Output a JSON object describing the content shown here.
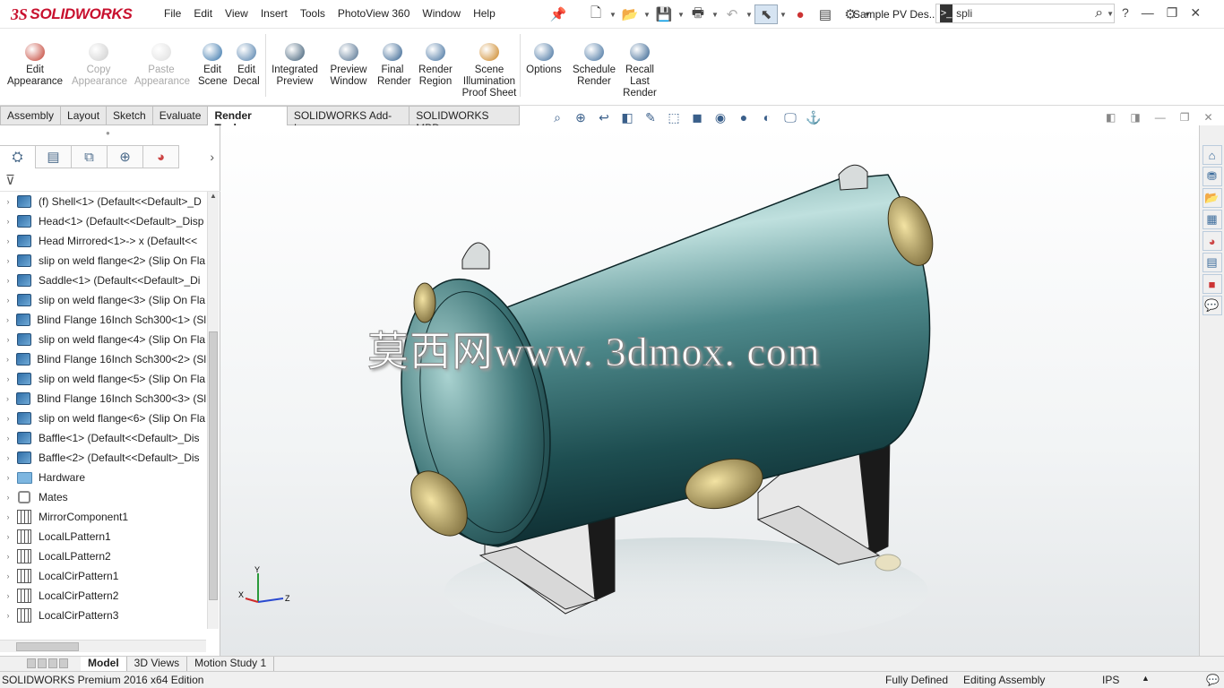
{
  "app": {
    "logo_ds": "3S",
    "logo_name": "SOLIDWORKS",
    "doc_title": "Sample PV Des..."
  },
  "menu": [
    "File",
    "Edit",
    "View",
    "Insert",
    "Tools",
    "PhotoView 360",
    "Window",
    "Help"
  ],
  "search": {
    "value": "spli"
  },
  "ribbon": [
    {
      "label": "Edit\nAppearance",
      "icon": "edit-appearance-icon",
      "enabled": true,
      "color": "#c0392b"
    },
    {
      "label": "Copy\nAppearance",
      "icon": "copy-appearance-icon",
      "enabled": false,
      "color": "#cccccc"
    },
    {
      "label": "Paste\nAppearance",
      "icon": "paste-appearance-icon",
      "enabled": false,
      "color": "#dddddd"
    },
    {
      "label": "Edit\nScene",
      "icon": "edit-scene-icon",
      "enabled": true,
      "color": "#2e6ea6"
    },
    {
      "label": "Edit\nDecal",
      "icon": "edit-decal-icon",
      "enabled": true,
      "color": "#4a7aa8"
    },
    {
      "label": "Integrated\nPreview",
      "icon": "integrated-preview-icon",
      "enabled": true,
      "color": "#35556f"
    },
    {
      "label": "Preview\nWindow",
      "icon": "preview-window-icon",
      "enabled": true,
      "color": "#4a6a8a"
    },
    {
      "label": "Final\nRender",
      "icon": "final-render-icon",
      "enabled": true,
      "color": "#2a5a8a"
    },
    {
      "label": "Render\nRegion",
      "icon": "render-region-icon",
      "enabled": true,
      "color": "#3a6a9a"
    },
    {
      "label": "Scene\nIllumination\nProof Sheet",
      "icon": "scene-illumination-icon",
      "enabled": true,
      "color": "#c9801a"
    },
    {
      "label": "Options",
      "icon": "options-icon",
      "enabled": true,
      "color": "#3a6a9a"
    },
    {
      "label": "Schedule\nRender",
      "icon": "schedule-render-icon",
      "enabled": true,
      "color": "#3a6a9a"
    },
    {
      "label": "Recall\nLast\nRender",
      "icon": "recall-last-render-icon",
      "enabled": true,
      "color": "#2a5a8a"
    }
  ],
  "cmd_tabs": [
    "Assembly",
    "Layout",
    "Sketch",
    "Evaluate",
    "Render Tools",
    "SOLIDWORKS Add-Ins",
    "SOLIDWORKS MBD"
  ],
  "active_cmd_tab": "Render Tools",
  "tree": [
    {
      "label": "(f) Shell<1> (Default<<Default>_D",
      "icon": "component"
    },
    {
      "label": "Head<1> (Default<<Default>_Disp",
      "icon": "component"
    },
    {
      "label": "Head Mirrored<1>-> x (Default<<",
      "icon": "component"
    },
    {
      "label": "slip on weld flange<2> (Slip On Fla",
      "icon": "component"
    },
    {
      "label": "Saddle<1> (Default<<Default>_Di",
      "icon": "component"
    },
    {
      "label": "slip on weld flange<3> (Slip On Fla",
      "icon": "component"
    },
    {
      "label": "Blind Flange 16Inch Sch300<1> (Sl",
      "icon": "component"
    },
    {
      "label": "slip on weld flange<4> (Slip On Fla",
      "icon": "component"
    },
    {
      "label": "Blind Flange 16Inch Sch300<2> (Sl",
      "icon": "component"
    },
    {
      "label": "slip on weld flange<5> (Slip On Fla",
      "icon": "component"
    },
    {
      "label": "Blind Flange 16Inch Sch300<3> (Sl",
      "icon": "component"
    },
    {
      "label": "slip on weld flange<6> (Slip On Fla",
      "icon": "component"
    },
    {
      "label": "Baffle<1> (Default<<Default>_Dis",
      "icon": "component"
    },
    {
      "label": "Baffle<2> (Default<<Default>_Dis",
      "icon": "component"
    },
    {
      "label": "Hardware",
      "icon": "folder"
    },
    {
      "label": "Mates",
      "icon": "mates"
    },
    {
      "label": "MirrorComponent1",
      "icon": "mirror"
    },
    {
      "label": "LocalLPattern1",
      "icon": "pattern"
    },
    {
      "label": "LocalLPattern2",
      "icon": "pattern"
    },
    {
      "label": "LocalCirPattern1",
      "icon": "pattern"
    },
    {
      "label": "LocalCirPattern2",
      "icon": "pattern"
    },
    {
      "label": "LocalCirPattern3",
      "icon": "pattern"
    }
  ],
  "watermark": "莫西网www. 3dmox. com",
  "triad": {
    "x": "X",
    "y": "Y",
    "z": "Z"
  },
  "bottom_tabs": [
    "Model",
    "3D Views",
    "Motion Study 1"
  ],
  "active_bottom_tab": "Model",
  "status": {
    "edition": "SOLIDWORKS Premium 2016 x64 Edition",
    "defined": "Fully Defined",
    "mode": "Editing Assembly",
    "units": "IPS"
  }
}
